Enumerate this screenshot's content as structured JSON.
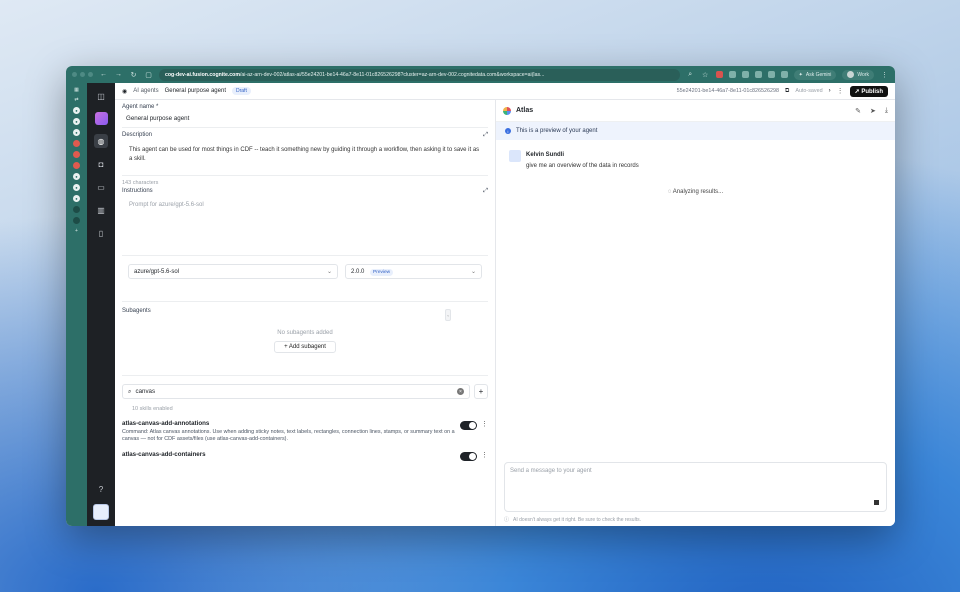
{
  "browser": {
    "url_host": "cog-dev-ai.fusion.cognite.com",
    "url_path": "/ai-az-arn-dev-002/atlas-ai/55e24201-be14-46a7-8e11-01c826526298?cluster=az-arn-dev-002.cognitedata.com&workspace=ai(las...",
    "ask_label": "Ask Gemini",
    "profile_label": "Work"
  },
  "header": {
    "crumb_root": "AI agents",
    "crumb_page": "General purpose agent",
    "status_badge": "Draft",
    "agent_id": "55e24201-be14-46a7-8e11-01c826526298",
    "autosave": "Auto-saved",
    "publish_label": "Publish"
  },
  "form": {
    "name_label": "Agent name *",
    "name_value": "General purpose agent",
    "desc_label": "Description",
    "desc_value": "This agent can be used for most things in CDF -- teach it something new by guiding it through a workflow, then asking it to save it as a skill.",
    "char_count": "143 characters",
    "instr_label": "Instructions",
    "instr_placeholder": "Prompt for azure/gpt-5.6-sol",
    "model_value": "azure/gpt-5.6-sol",
    "version_value": "2.0.0",
    "version_badge": "Preview",
    "subagents_label": "Subagents",
    "subagents_empty": "No subagents added",
    "add_subagent": "+ Add subagent",
    "search_value": "canvas",
    "skills_enabled": "10 skills enabled"
  },
  "skills": [
    {
      "name": "atlas-canvas-add-annotations",
      "desc": "Command: Atlas canvas annotations. Use when adding sticky notes, text labels, rectangles, connection lines, stamps, or summary text on a canvas — not for CDF assets/files (use atlas-canvas-add-containers).",
      "enabled": true
    },
    {
      "name": "atlas-canvas-add-containers",
      "desc": "",
      "enabled": true
    }
  ],
  "chat": {
    "title": "Atlas",
    "banner": "This is a preview of your agent",
    "user_name": "Kelvin Sundli",
    "user_msg": "give me an overview of the data in records",
    "status": "Analyzing results...",
    "composer_placeholder": "Send a message to your agent",
    "disclaimer": "AI doesn't always get it right. Be sure to check the results."
  },
  "colors": {
    "rail": "#2d6f68",
    "sidebar": "#1e2125",
    "accent": "#2f5fc4"
  }
}
